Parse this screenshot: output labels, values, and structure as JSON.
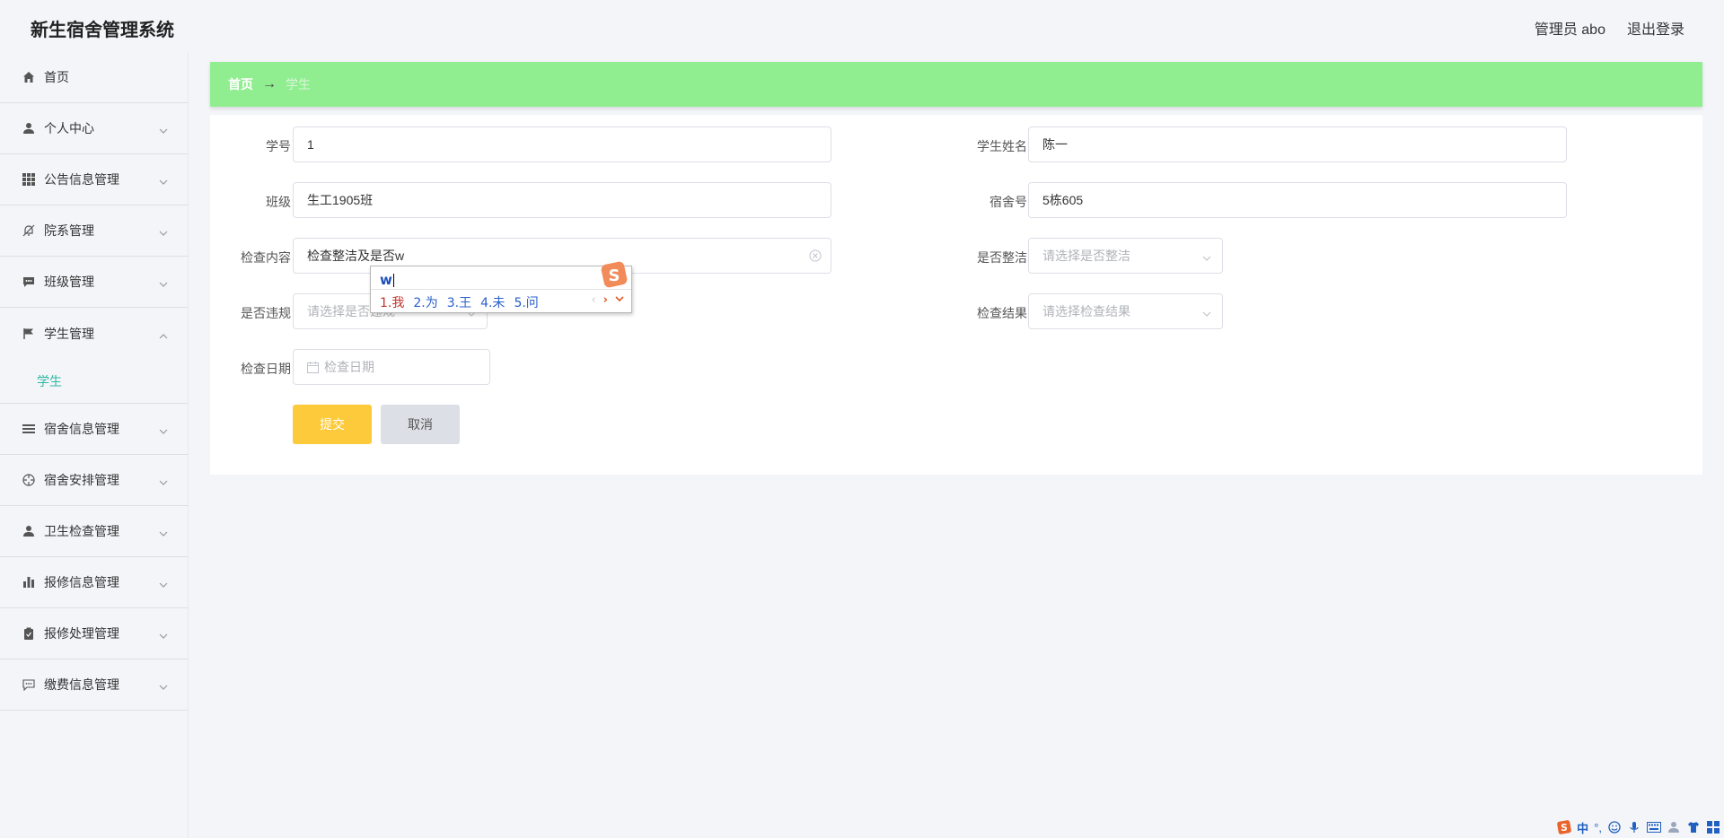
{
  "app": {
    "title": "新生宿舍管理系统"
  },
  "header": {
    "user": "管理员 abo",
    "logout": "退出登录"
  },
  "sidebar": {
    "items": [
      {
        "label": "首页",
        "icon": "home-icon"
      },
      {
        "label": "个人中心",
        "icon": "user-icon"
      },
      {
        "label": "公告信息管理",
        "icon": "grid-icon"
      },
      {
        "label": "院系管理",
        "icon": "bell-off-icon"
      },
      {
        "label": "班级管理",
        "icon": "chat-icon"
      },
      {
        "label": "学生管理",
        "icon": "flag-icon"
      },
      {
        "label": "宿舍信息管理",
        "icon": "list-icon"
      },
      {
        "label": "宿舍安排管理",
        "icon": "target-icon"
      },
      {
        "label": "卫生检查管理",
        "icon": "user-icon"
      },
      {
        "label": "报修信息管理",
        "icon": "bar-chart-icon"
      },
      {
        "label": "报修处理管理",
        "icon": "clipboard-icon"
      },
      {
        "label": "缴费信息管理",
        "icon": "chat-dots-icon"
      }
    ],
    "submenu": {
      "label": "学生"
    }
  },
  "breadcrumb": {
    "home": "首页",
    "separator": "→",
    "current": "学生"
  },
  "form": {
    "student_no": {
      "label": "学号",
      "value": "1"
    },
    "student_name": {
      "label": "学生姓名",
      "value": "陈一"
    },
    "class": {
      "label": "班级",
      "value": "生工1905班"
    },
    "dorm_no": {
      "label": "宿舍号",
      "value": "5栋605"
    },
    "check_content": {
      "label": "检查内容",
      "value": "检查整洁及是否w"
    },
    "is_tidy": {
      "label": "是否整洁",
      "placeholder": "请选择是否整洁"
    },
    "is_violation": {
      "label": "是否违规",
      "placeholder": "请选择是否违规"
    },
    "check_result": {
      "label": "检查结果",
      "placeholder": "请选择检查结果"
    },
    "check_date": {
      "label": "检查日期",
      "placeholder": "检查日期"
    },
    "submit": "提交",
    "cancel": "取消"
  },
  "ime": {
    "input": "w",
    "candidates": [
      "1.我",
      "2.为",
      "3.王",
      "4.未",
      "5.问"
    ]
  },
  "tray": {
    "lang": "中",
    "punct": "°,"
  },
  "colors": {
    "breadcrumb_bg": "#90ee90",
    "submit_bg": "#fcca3a",
    "accent": "#2fb8a4"
  }
}
